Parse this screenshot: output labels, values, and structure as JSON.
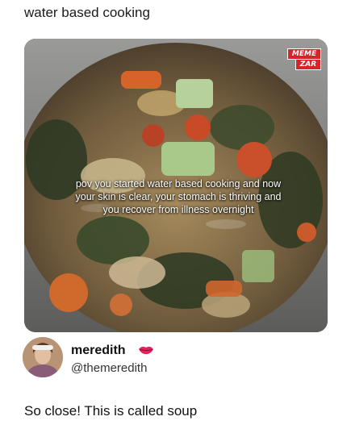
{
  "post": {
    "caption": "water based cooking"
  },
  "image": {
    "overlay_text": "pov you started water based cooking and now your skin is clear, your stomach is thriving and you recover from illness overnight",
    "watermark_top": "MEME",
    "watermark_bottom": "ZAR",
    "watermark_color": "#d8232a"
  },
  "author": {
    "name": "meredith",
    "handle": "@themeredith",
    "badge_icon": "lips-icon"
  },
  "reply": {
    "text": "So close! This is called soup"
  }
}
